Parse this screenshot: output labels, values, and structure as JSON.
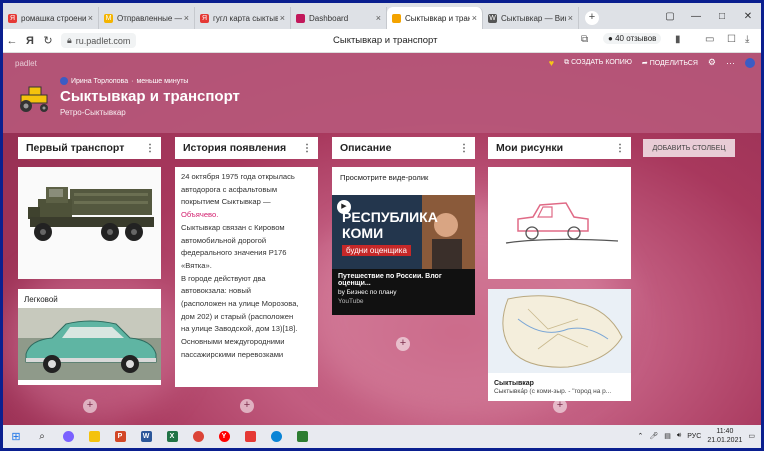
{
  "browser": {
    "tabs": [
      {
        "label": "ромашка строение —",
        "favicon": "yandex-icon",
        "color": "#e53935"
      },
      {
        "label": "Отправленные — Янд",
        "favicon": "mail-icon",
        "color": "#f4b400"
      },
      {
        "label": "гугл карта сыктывкар",
        "favicon": "yandex-icon",
        "color": "#e53935"
      },
      {
        "label": "Dashboard",
        "favicon": "dashboard-icon",
        "color": "#c2185b"
      },
      {
        "label": "Сыктывкар и трансп",
        "favicon": "tractor-icon",
        "color": "#f4a300",
        "active": true
      },
      {
        "label": "Сыктывкар — Викип",
        "favicon": "wikipedia-icon",
        "color": "#555555"
      }
    ],
    "new_tab_label": "+",
    "url": "ru.padlet.com",
    "page_title": "Сыктывкар и транспорт",
    "reviews_label": "40 отзывов"
  },
  "padlet": {
    "brand": "padlet",
    "actions": {
      "copy_label": "СОЗДАТЬ КОПИЮ",
      "share_label": "ПОДЕЛИТЬСЯ"
    },
    "author": "Ирина Торлопова",
    "updated": "меньше минуты",
    "title": "Сыктывкар и транспорт",
    "subtitle": "Ретро-Сыктывкар",
    "add_column_label": "ДОБАВИТЬ СТОЛБЕЦ",
    "columns": [
      {
        "title": "Первый транспорт",
        "cards": [
          {
            "title": ""
          },
          {
            "title": "Легковой"
          }
        ]
      },
      {
        "title": "История появления",
        "text_lines": [
          "24 октября 1975 года открылась",
          "автодорога с асфальтовым",
          "покрытием Сыктывкар —",
          "Объячево.",
          "Сыктывкар связан с Кировом",
          "автомобильной дорогой",
          "федерального значения Р176",
          "«Вятка».",
          "В городе действуют два",
          "автовокзала: новый",
          "(расположен на улице Морозова,",
          "дом 202) и старый (расположен",
          "на улице Заводской, дом 13)[18].",
          "Основными междугородними",
          "пассажирскими перевозками"
        ]
      },
      {
        "title": "Описание",
        "prompt": "Просмотрите виде-ролик",
        "video": {
          "overlay_line1": "РЕСПУБЛИКА",
          "overlay_line2": "КОМИ",
          "overlay_tag": "будни оценщика",
          "title": "Путешествие по России. Влог оценщи...",
          "author": "by Бизнес по плану",
          "source": "YouTube"
        }
      },
      {
        "title": "Мои рисунки",
        "map_card": {
          "title": "Сыктывкар",
          "desc": "Сыктывка́р (с коми-зыр. - \"город на р..."
        }
      }
    ],
    "plus_label": "+"
  },
  "taskbar": {
    "lang": "РУС",
    "time": "11:40",
    "date": "21.01.2021"
  }
}
